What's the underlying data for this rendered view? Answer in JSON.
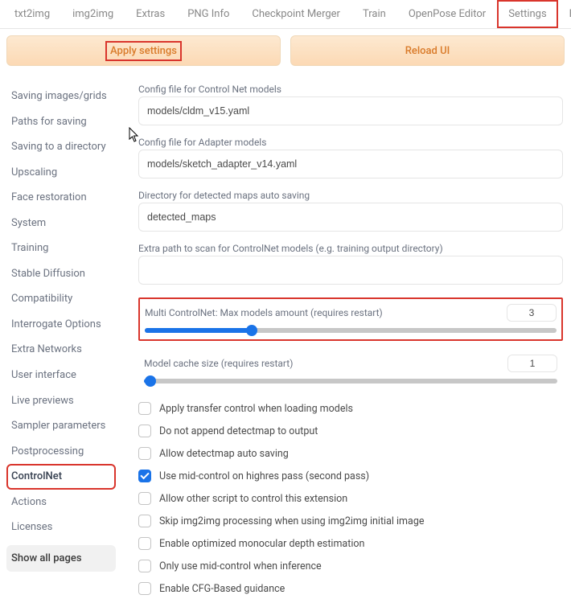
{
  "tabs": [
    "txt2img",
    "img2img",
    "Extras",
    "PNG Info",
    "Checkpoint Merger",
    "Train",
    "OpenPose Editor",
    "Settings",
    "Extensions"
  ],
  "tabs_highlight": "Settings",
  "buttons": {
    "apply": "Apply settings",
    "reload": "Reload UI"
  },
  "sidebar": {
    "items": [
      "Saving images/grids",
      "Paths for saving",
      "Saving to a directory",
      "Upscaling",
      "Face restoration",
      "System",
      "Training",
      "Stable Diffusion",
      "Compatibility",
      "Interrogate Options",
      "Extra Networks",
      "User interface",
      "Live previews",
      "Sampler parameters",
      "Postprocessing",
      "ControlNet",
      "Actions",
      "Licenses"
    ],
    "highlight": "ControlNet",
    "show_all": "Show all pages"
  },
  "fields": {
    "config_cn": {
      "label": "Config file for Control Net models",
      "value": "models/cldm_v15.yaml"
    },
    "config_adapter": {
      "label": "Config file for Adapter models",
      "value": "models/sketch_adapter_v14.yaml"
    },
    "detected_dir": {
      "label": "Directory for detected maps auto saving",
      "value": "detected_maps"
    },
    "extra_path": {
      "label": "Extra path to scan for ControlNet models (e.g. training output directory)",
      "value": ""
    }
  },
  "sliders": {
    "multi": {
      "label": "Multi ControlNet: Max models amount (requires restart)",
      "value": "3",
      "pct": 26
    },
    "cache": {
      "label": "Model cache size (requires restart)",
      "value": "1",
      "pct": 1.5
    }
  },
  "checks": [
    {
      "label": "Apply transfer control when loading models",
      "checked": false
    },
    {
      "label": "Do not append detectmap to output",
      "checked": false
    },
    {
      "label": "Allow detectmap auto saving",
      "checked": false
    },
    {
      "label": "Use mid-control on highres pass (second pass)",
      "checked": true
    },
    {
      "label": "Allow other script to control this extension",
      "checked": false
    },
    {
      "label": "Skip img2img processing when using img2img initial image",
      "checked": false
    },
    {
      "label": "Enable optimized monocular depth estimation",
      "checked": false
    },
    {
      "label": "Only use mid-control when inference",
      "checked": false
    },
    {
      "label": "Enable CFG-Based guidance",
      "checked": false
    }
  ]
}
